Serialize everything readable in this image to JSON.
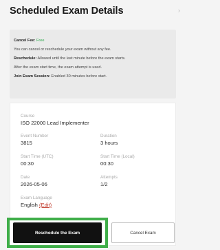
{
  "header": {
    "title": "Scheduled Exam Details"
  },
  "policy": {
    "cancel_fee_label": "Cancel Fee:",
    "cancel_fee_value": "Free",
    "line1": "You can cancel or reschedule your exam without any fee.",
    "reschedule_label": "Reschedule:",
    "reschedule_text": "Allowed until the last minute before the exam starts.",
    "line3": "After the exam start time, the exam attempt is used.",
    "join_label": "Join Exam Session:",
    "join_text": "Enabled 30 minutes before start."
  },
  "details": {
    "course_label": "Course",
    "course_value": "ISO 22000 Lead Implementer",
    "event_label": "Event Number",
    "event_value": "3815",
    "duration_label": "Duration",
    "duration_value": "3 hours",
    "start_utc_label": "Start Time (UTC)",
    "start_utc_value": "00:30",
    "start_local_label": "Start Time (Local)",
    "start_local_value": "00:30",
    "date_label": "Date",
    "date_value": "2026-05-06",
    "attempts_label": "Attempts",
    "attempts_value": "1/2",
    "language_label": "Exam Language",
    "language_value": "English",
    "edit_link": "(Edit)"
  },
  "actions": {
    "reschedule_label": "Reschedule the Exam",
    "cancel_label": "Cancel Exam"
  },
  "colors": {
    "highlight": "#3fae49",
    "free": "#2aa84a",
    "edit": "#c0392b"
  }
}
